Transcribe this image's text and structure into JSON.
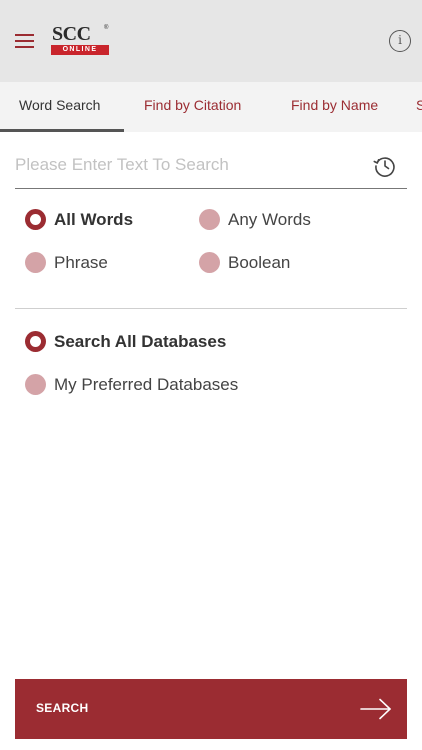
{
  "header": {
    "logo_text": "SCC",
    "logo_reg": "®",
    "logo_sub": "ONLINE",
    "info_label": "i"
  },
  "tabs": [
    {
      "label": "Word Search",
      "active": true
    },
    {
      "label": "Find by Citation",
      "active": false
    },
    {
      "label": "Find by Name",
      "active": false
    },
    {
      "label": "S",
      "active": false
    }
  ],
  "search": {
    "placeholder": "Please Enter Text To Search",
    "value": ""
  },
  "match_options": [
    {
      "label": "All Words",
      "checked": true
    },
    {
      "label": "Any Words",
      "checked": false
    },
    {
      "label": "Phrase",
      "checked": false
    },
    {
      "label": "Boolean",
      "checked": false
    }
  ],
  "database_options": [
    {
      "label": "Search All Databases",
      "checked": true
    },
    {
      "label": "My Preferred Databases",
      "checked": false
    }
  ],
  "action": {
    "search_label": "SEARCH"
  },
  "colors": {
    "accent": "#9b2c32",
    "radio_unchecked": "#d4a3a7",
    "header_bg": "#e6e6e6",
    "tabs_bg": "#f3f3f3"
  }
}
